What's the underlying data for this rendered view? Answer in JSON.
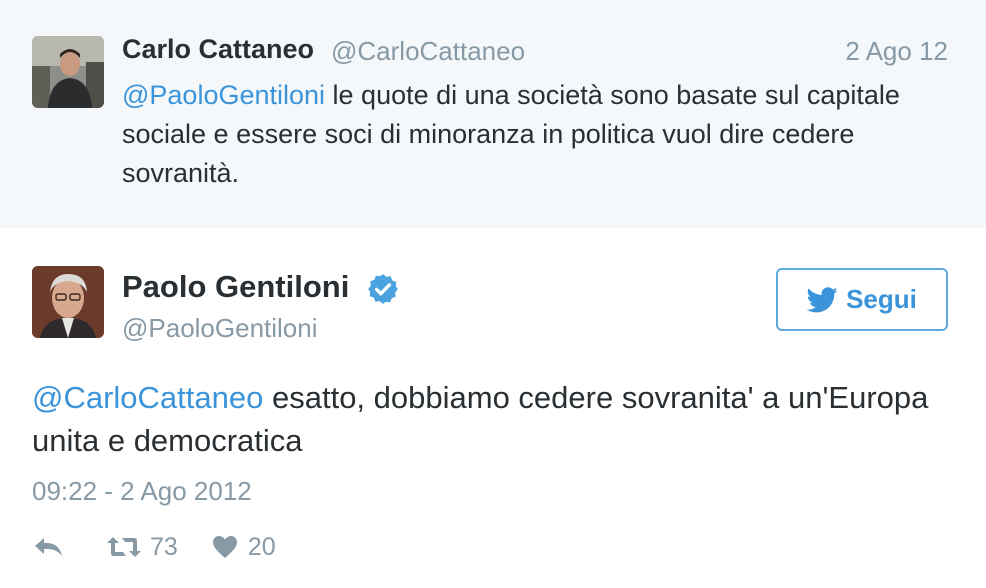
{
  "parent_tweet": {
    "name": "Carlo Cattaneo",
    "handle": "@CarloCattaneo",
    "date": "2 Ago 12",
    "mention": "@PaoloGentiloni",
    "text": " le quote di una società sono basate sul capitale sociale e essere soci di minoranza in politica vuol dire cedere sovranità."
  },
  "tweet": {
    "name": "Paolo Gentiloni",
    "handle": "@PaoloGentiloni",
    "verified": true,
    "follow_label": "Segui",
    "mention": "@CarloCattaneo",
    "text": " esatto, dobbiamo cedere sovranita' a un'Europa unita e democratica",
    "timestamp": "09:22 - 2 Ago 2012",
    "retweets": "73",
    "likes": "20"
  },
  "colors": {
    "link": "#3b94d9",
    "muted": "#8899a6",
    "text": "#292f33",
    "parent_bg": "#f5f8fa",
    "verified": "#4aa3df"
  },
  "icons": {
    "reply": "reply-icon",
    "retweet": "retweet-icon",
    "like": "heart-icon",
    "follow": "twitter-bird-icon",
    "verified": "verified-badge-icon"
  }
}
